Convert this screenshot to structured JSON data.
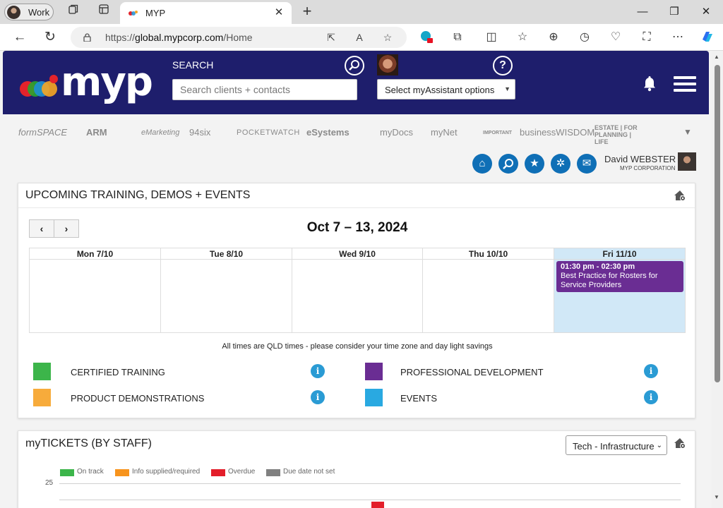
{
  "browser": {
    "profile_label": "Work",
    "tab_title": "MYP",
    "url_prefix": "https://",
    "url_host": "global.mypcorp.com",
    "url_path": "/Home"
  },
  "header": {
    "search_label": "SEARCH",
    "search_placeholder": "Search clients + contacts",
    "assistant_select": "Select myAssistant options",
    "logo_text": "myp",
    "help_glyph": "?"
  },
  "brands": [
    "formSPACE",
    "ARM",
    "eMarketing",
    "94six",
    "POCKETWATCH",
    "eSystems",
    "myDocs",
    "myNet",
    "IMPORTANT",
    "businessWISDOM",
    "ESTATE | FOR PLANNING | LIFE"
  ],
  "user": {
    "name": "David WEBSTER",
    "org": "MYP CORPORATION"
  },
  "training": {
    "title": "UPCOMING TRAINING, DEMOS + EVENTS",
    "range": "Oct 7 – 13, 2024",
    "days": [
      "Mon 7/10",
      "Tue 8/10",
      "Wed 9/10",
      "Thu 10/10",
      "Fri 11/10"
    ],
    "event": {
      "time": "01:30 pm - 02:30 pm",
      "title": "Best Practice for Rosters for Service Providers",
      "color": "#6a2d93"
    },
    "timezone_note": "All times are QLD times - please consider your time zone and day light savings",
    "legend": [
      {
        "label": "CERTIFIED TRAINING",
        "color": "#3cb54a"
      },
      {
        "label": "PROFESSIONAL DEVELOPMENT",
        "color": "#6a2d93"
      },
      {
        "label": "PRODUCT DEMONSTRATIONS",
        "color": "#f7ab3b"
      },
      {
        "label": "EVENTS",
        "color": "#29a9e1"
      }
    ]
  },
  "tickets": {
    "title": "myTICKETS (BY STAFF)",
    "filter_value": "Tech - Infrastructure",
    "legend": [
      {
        "label": "On track",
        "color": "#3cb54a"
      },
      {
        "label": "Info supplied/required",
        "color": "#f7941d"
      },
      {
        "label": "Overdue",
        "color": "#e31e2a"
      },
      {
        "label": "Due date not set",
        "color": "#808080"
      }
    ],
    "y_tick_top": "25"
  },
  "colors": {
    "header_bg": "#1e1e6c",
    "action_blue": "#0f6fb6",
    "info_blue": "#2a9bd4",
    "today_bg": "#d1e8f7"
  }
}
